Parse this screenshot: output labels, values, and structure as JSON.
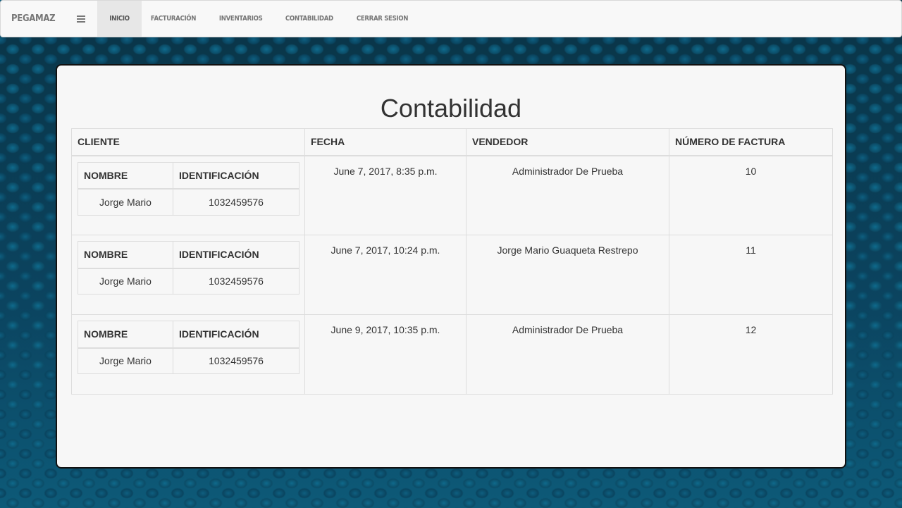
{
  "navbar": {
    "brand": "PEGAMAZ",
    "items": [
      {
        "label": "INICIO",
        "active": true
      },
      {
        "label": "FACTURACIÓN",
        "active": false
      },
      {
        "label": "INVENTARIOS",
        "active": false
      },
      {
        "label": "CONTABILIDAD",
        "active": false
      },
      {
        "label": "CERRAR SESION",
        "active": false
      }
    ]
  },
  "main": {
    "title": "Contabilidad",
    "table": {
      "headers": {
        "cliente": "CLIENTE",
        "fecha": "FECHA",
        "vendedor": "VENDEDOR",
        "factura": "NÚMERO DE FACTURA"
      },
      "client_headers": {
        "nombre": "NOMBRE",
        "identificacion": "IDENTIFICACIÓN"
      },
      "rows": [
        {
          "nombre": "Jorge Mario",
          "identificacion": "1032459576",
          "fecha": "June 7, 2017, 8:35 p.m.",
          "vendedor": "Administrador De Prueba",
          "factura": "10"
        },
        {
          "nombre": "Jorge Mario",
          "identificacion": "1032459576",
          "fecha": "June 7, 2017, 10:24 p.m.",
          "vendedor": "Jorge Mario Guaqueta Restrepo",
          "factura": "11"
        },
        {
          "nombre": "Jorge Mario",
          "identificacion": "1032459576",
          "fecha": "June 9, 2017, 10:35 p.m.",
          "vendedor": "Administrador De Prueba",
          "factura": "12"
        }
      ]
    }
  }
}
